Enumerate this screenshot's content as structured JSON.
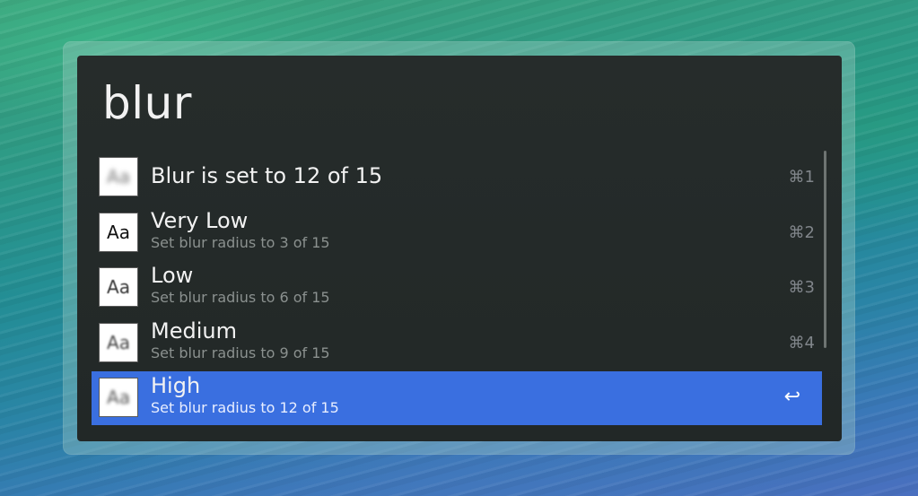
{
  "search": {
    "query": "blur"
  },
  "results": [
    {
      "title": "Blur is set to 12 of 15",
      "subtitle": "",
      "shortcut": "⌘1",
      "icon": "font-preview-icon",
      "thumb_text": "Aa",
      "selected": false
    },
    {
      "title": "Very Low",
      "subtitle": "Set blur radius to 3 of 15",
      "shortcut": "⌘2",
      "icon": "font-preview-icon",
      "thumb_text": "Aa",
      "selected": false
    },
    {
      "title": "Low",
      "subtitle": "Set blur radius to 6 of 15",
      "shortcut": "⌘3",
      "icon": "font-preview-icon",
      "thumb_text": "Aa",
      "selected": false
    },
    {
      "title": "Medium",
      "subtitle": "Set blur radius to 9 of 15",
      "shortcut": "⌘4",
      "icon": "font-preview-icon",
      "thumb_text": "Aa",
      "selected": false
    },
    {
      "title": "High",
      "subtitle": "Set blur radius to 12 of 15",
      "shortcut": "↩",
      "icon": "font-preview-icon",
      "thumb_text": "Aa",
      "selected": true
    }
  ],
  "colors": {
    "selection": "#3a6fe0",
    "panel": "#242a29",
    "subtitle": "#8b918f"
  }
}
